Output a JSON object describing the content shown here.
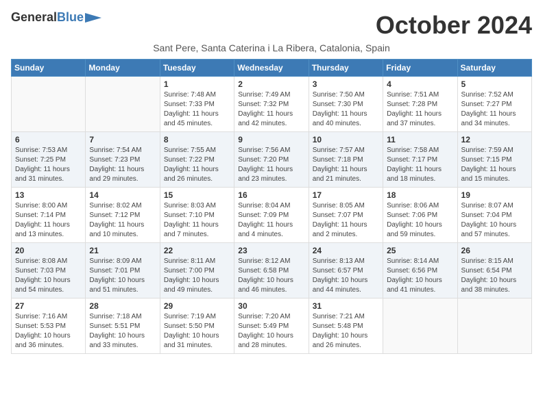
{
  "logo": {
    "general": "General",
    "blue": "Blue"
  },
  "title": "October 2024",
  "subtitle": "Sant Pere, Santa Caterina i La Ribera, Catalonia, Spain",
  "weekdays": [
    "Sunday",
    "Monday",
    "Tuesday",
    "Wednesday",
    "Thursday",
    "Friday",
    "Saturday"
  ],
  "weeks": [
    [
      {
        "day": "",
        "sunrise": "",
        "sunset": "",
        "daylight": ""
      },
      {
        "day": "",
        "sunrise": "",
        "sunset": "",
        "daylight": ""
      },
      {
        "day": "1",
        "sunrise": "Sunrise: 7:48 AM",
        "sunset": "Sunset: 7:33 PM",
        "daylight": "Daylight: 11 hours and 45 minutes."
      },
      {
        "day": "2",
        "sunrise": "Sunrise: 7:49 AM",
        "sunset": "Sunset: 7:32 PM",
        "daylight": "Daylight: 11 hours and 42 minutes."
      },
      {
        "day": "3",
        "sunrise": "Sunrise: 7:50 AM",
        "sunset": "Sunset: 7:30 PM",
        "daylight": "Daylight: 11 hours and 40 minutes."
      },
      {
        "day": "4",
        "sunrise": "Sunrise: 7:51 AM",
        "sunset": "Sunset: 7:28 PM",
        "daylight": "Daylight: 11 hours and 37 minutes."
      },
      {
        "day": "5",
        "sunrise": "Sunrise: 7:52 AM",
        "sunset": "Sunset: 7:27 PM",
        "daylight": "Daylight: 11 hours and 34 minutes."
      }
    ],
    [
      {
        "day": "6",
        "sunrise": "Sunrise: 7:53 AM",
        "sunset": "Sunset: 7:25 PM",
        "daylight": "Daylight: 11 hours and 31 minutes."
      },
      {
        "day": "7",
        "sunrise": "Sunrise: 7:54 AM",
        "sunset": "Sunset: 7:23 PM",
        "daylight": "Daylight: 11 hours and 29 minutes."
      },
      {
        "day": "8",
        "sunrise": "Sunrise: 7:55 AM",
        "sunset": "Sunset: 7:22 PM",
        "daylight": "Daylight: 11 hours and 26 minutes."
      },
      {
        "day": "9",
        "sunrise": "Sunrise: 7:56 AM",
        "sunset": "Sunset: 7:20 PM",
        "daylight": "Daylight: 11 hours and 23 minutes."
      },
      {
        "day": "10",
        "sunrise": "Sunrise: 7:57 AM",
        "sunset": "Sunset: 7:18 PM",
        "daylight": "Daylight: 11 hours and 21 minutes."
      },
      {
        "day": "11",
        "sunrise": "Sunrise: 7:58 AM",
        "sunset": "Sunset: 7:17 PM",
        "daylight": "Daylight: 11 hours and 18 minutes."
      },
      {
        "day": "12",
        "sunrise": "Sunrise: 7:59 AM",
        "sunset": "Sunset: 7:15 PM",
        "daylight": "Daylight: 11 hours and 15 minutes."
      }
    ],
    [
      {
        "day": "13",
        "sunrise": "Sunrise: 8:00 AM",
        "sunset": "Sunset: 7:14 PM",
        "daylight": "Daylight: 11 hours and 13 minutes."
      },
      {
        "day": "14",
        "sunrise": "Sunrise: 8:02 AM",
        "sunset": "Sunset: 7:12 PM",
        "daylight": "Daylight: 11 hours and 10 minutes."
      },
      {
        "day": "15",
        "sunrise": "Sunrise: 8:03 AM",
        "sunset": "Sunset: 7:10 PM",
        "daylight": "Daylight: 11 hours and 7 minutes."
      },
      {
        "day": "16",
        "sunrise": "Sunrise: 8:04 AM",
        "sunset": "Sunset: 7:09 PM",
        "daylight": "Daylight: 11 hours and 4 minutes."
      },
      {
        "day": "17",
        "sunrise": "Sunrise: 8:05 AM",
        "sunset": "Sunset: 7:07 PM",
        "daylight": "Daylight: 11 hours and 2 minutes."
      },
      {
        "day": "18",
        "sunrise": "Sunrise: 8:06 AM",
        "sunset": "Sunset: 7:06 PM",
        "daylight": "Daylight: 10 hours and 59 minutes."
      },
      {
        "day": "19",
        "sunrise": "Sunrise: 8:07 AM",
        "sunset": "Sunset: 7:04 PM",
        "daylight": "Daylight: 10 hours and 57 minutes."
      }
    ],
    [
      {
        "day": "20",
        "sunrise": "Sunrise: 8:08 AM",
        "sunset": "Sunset: 7:03 PM",
        "daylight": "Daylight: 10 hours and 54 minutes."
      },
      {
        "day": "21",
        "sunrise": "Sunrise: 8:09 AM",
        "sunset": "Sunset: 7:01 PM",
        "daylight": "Daylight: 10 hours and 51 minutes."
      },
      {
        "day": "22",
        "sunrise": "Sunrise: 8:11 AM",
        "sunset": "Sunset: 7:00 PM",
        "daylight": "Daylight: 10 hours and 49 minutes."
      },
      {
        "day": "23",
        "sunrise": "Sunrise: 8:12 AM",
        "sunset": "Sunset: 6:58 PM",
        "daylight": "Daylight: 10 hours and 46 minutes."
      },
      {
        "day": "24",
        "sunrise": "Sunrise: 8:13 AM",
        "sunset": "Sunset: 6:57 PM",
        "daylight": "Daylight: 10 hours and 44 minutes."
      },
      {
        "day": "25",
        "sunrise": "Sunrise: 8:14 AM",
        "sunset": "Sunset: 6:56 PM",
        "daylight": "Daylight: 10 hours and 41 minutes."
      },
      {
        "day": "26",
        "sunrise": "Sunrise: 8:15 AM",
        "sunset": "Sunset: 6:54 PM",
        "daylight": "Daylight: 10 hours and 38 minutes."
      }
    ],
    [
      {
        "day": "27",
        "sunrise": "Sunrise: 7:16 AM",
        "sunset": "Sunset: 5:53 PM",
        "daylight": "Daylight: 10 hours and 36 minutes."
      },
      {
        "day": "28",
        "sunrise": "Sunrise: 7:18 AM",
        "sunset": "Sunset: 5:51 PM",
        "daylight": "Daylight: 10 hours and 33 minutes."
      },
      {
        "day": "29",
        "sunrise": "Sunrise: 7:19 AM",
        "sunset": "Sunset: 5:50 PM",
        "daylight": "Daylight: 10 hours and 31 minutes."
      },
      {
        "day": "30",
        "sunrise": "Sunrise: 7:20 AM",
        "sunset": "Sunset: 5:49 PM",
        "daylight": "Daylight: 10 hours and 28 minutes."
      },
      {
        "day": "31",
        "sunrise": "Sunrise: 7:21 AM",
        "sunset": "Sunset: 5:48 PM",
        "daylight": "Daylight: 10 hours and 26 minutes."
      },
      {
        "day": "",
        "sunrise": "",
        "sunset": "",
        "daylight": ""
      },
      {
        "day": "",
        "sunrise": "",
        "sunset": "",
        "daylight": ""
      }
    ]
  ]
}
